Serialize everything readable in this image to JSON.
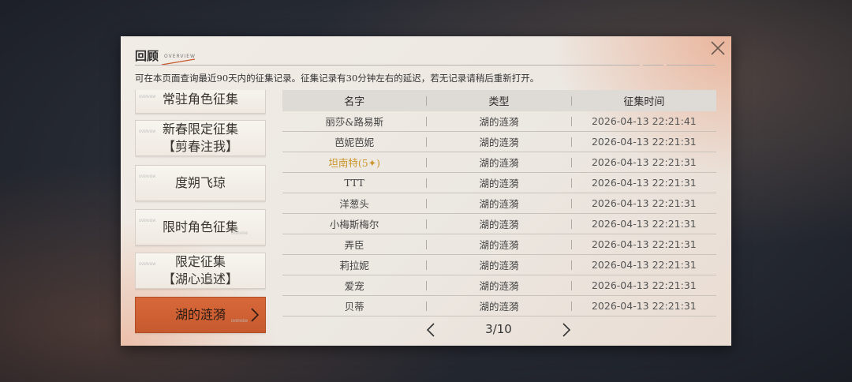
{
  "dialog": {
    "title": "回顾",
    "title_sub": "OVERVIEW",
    "notice": "可在本页面查询最近90天内的征集记录。征集记录有30分钟左右的延迟，若无记录请稍后重新打开。",
    "close_icon": "close-icon"
  },
  "sidebar": {
    "items": [
      {
        "label": "常驻角色征集",
        "active": false
      },
      {
        "label": "新春限定征集\n【剪春注我】",
        "active": false
      },
      {
        "label": "度朔飞琼",
        "active": false
      },
      {
        "label": "限时角色征集",
        "active": false
      },
      {
        "label": "限定征集\n【湖心追述】",
        "active": false
      },
      {
        "label": "湖的涟漪",
        "active": true
      }
    ],
    "deco_text": "OVERVIEW",
    "accent_color": "#c65a2e"
  },
  "table": {
    "headers": [
      "名字",
      "类型",
      "征集时间"
    ],
    "rows": [
      {
        "name": "丽莎&路易斯",
        "type": "湖的涟漪",
        "time": "2026-04-13 22:21:41",
        "highlight": false
      },
      {
        "name": "芭妮芭妮",
        "type": "湖的涟漪",
        "time": "2026-04-13 22:21:31",
        "highlight": false
      },
      {
        "name": "坦南特(5✦)",
        "type": "湖的涟漪",
        "time": "2026-04-13 22:21:31",
        "highlight": true
      },
      {
        "name": "TTT",
        "type": "湖的涟漪",
        "time": "2026-04-13 22:21:31",
        "highlight": false
      },
      {
        "name": "洋葱头",
        "type": "湖的涟漪",
        "time": "2026-04-13 22:21:31",
        "highlight": false
      },
      {
        "name": "小梅斯梅尔",
        "type": "湖的涟漪",
        "time": "2026-04-13 22:21:31",
        "highlight": false
      },
      {
        "name": "弄臣",
        "type": "湖的涟漪",
        "time": "2026-04-13 22:21:31",
        "highlight": false
      },
      {
        "name": "莉拉妮",
        "type": "湖的涟漪",
        "time": "2026-04-13 22:21:31",
        "highlight": false
      },
      {
        "name": "爱宠",
        "type": "湖的涟漪",
        "time": "2026-04-13 22:21:31",
        "highlight": false
      },
      {
        "name": "贝蒂",
        "type": "湖的涟漪",
        "time": "2026-04-13 22:21:31",
        "highlight": false
      }
    ],
    "highlight_color": "#c9962e"
  },
  "pager": {
    "text": "3/10",
    "prev_icon": "chevron-left-icon",
    "next_icon": "chevron-right-icon"
  }
}
